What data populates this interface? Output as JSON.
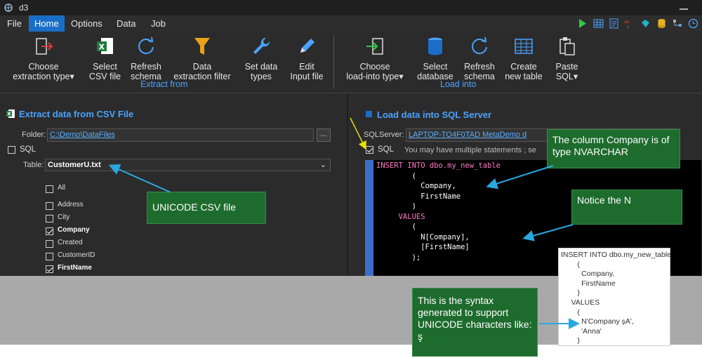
{
  "app": {
    "title": "d3"
  },
  "menu": [
    "File",
    "Home",
    "Options",
    "Data",
    "Job"
  ],
  "ribbon": {
    "extract_buttons": [
      {
        "line1": "Choose",
        "line2": "extraction type",
        "dropdown": true
      },
      {
        "line1": "Select",
        "line2": "CSV file",
        "dropdown": false
      },
      {
        "line1": "Refresh",
        "line2": "schema",
        "dropdown": false
      },
      {
        "line1": "Data",
        "line2": "extraction filter",
        "dropdown": false
      },
      {
        "line1": "Set data",
        "line2": "types",
        "dropdown": false
      },
      {
        "line1": "Edit",
        "line2": "Input file",
        "dropdown": false
      }
    ],
    "extract_group_label": "Extract from",
    "load_buttons": [
      {
        "line1": "Choose",
        "line2": "load-into type",
        "dropdown": true
      },
      {
        "line1": "Select",
        "line2": "database",
        "dropdown": false
      },
      {
        "line1": "Refresh",
        "line2": "schema",
        "dropdown": false
      },
      {
        "line1": "Create",
        "line2": "new table",
        "dropdown": false
      },
      {
        "line1": "Paste",
        "line2": "SQL",
        "dropdown": true
      }
    ],
    "load_group_label": "Load into"
  },
  "extract_panel": {
    "title": "Extract data from CSV File",
    "folder_label": "Folder:",
    "folder_value": "C:\\Demo\\DataFiles",
    "browse_label": "...",
    "sql_label": "SQL",
    "table_label": "Table:",
    "table_value": "CustomerU.txt",
    "columns": [
      {
        "name": "All",
        "checked": false,
        "bold": false
      },
      {
        "name": "Address",
        "checked": false,
        "bold": false
      },
      {
        "name": "City",
        "checked": false,
        "bold": false
      },
      {
        "name": "Company",
        "checked": true,
        "bold": true
      },
      {
        "name": "Created",
        "checked": false,
        "bold": false
      },
      {
        "name": "CustomerID",
        "checked": false,
        "bold": false
      },
      {
        "name": "FirstName",
        "checked": true,
        "bold": true
      }
    ]
  },
  "load_panel": {
    "title": "Load data into SQL Server",
    "server_label": "SQLServer:",
    "server_value": "LAPTOP-TO4F0TAD    MetaDemo    d",
    "sql_label": "SQL",
    "sql_hint": "You may have multiple statements ; se",
    "code_lines": [
      "INSERT INTO dbo.my_new_table",
      "        (",
      "          Company,",
      "          FirstName",
      "        )",
      "     VALUES",
      "        (",
      "          N[Company],",
      "          [FirstName]",
      "        );"
    ]
  },
  "callouts": {
    "unicode_csv": "UNICODE CSV file",
    "company_type": "The column Company is of type NVARCHAR",
    "notice_n": "Notice the N",
    "syntax": "This is the syntax generated to support UNICODE characters like:  ş"
  },
  "sample_sql": [
    "INSERT INTO dbo.my_new_table",
    "        (",
    "          Company,",
    "          FirstName",
    "        )",
    "     VALUES",
    "        (",
    "          N'Company şA',",
    "          'Anna'",
    "        )"
  ],
  "colors": {
    "accent": "#1a6ec7",
    "link": "#5ab0ff",
    "callout": "#1e6b2e"
  }
}
